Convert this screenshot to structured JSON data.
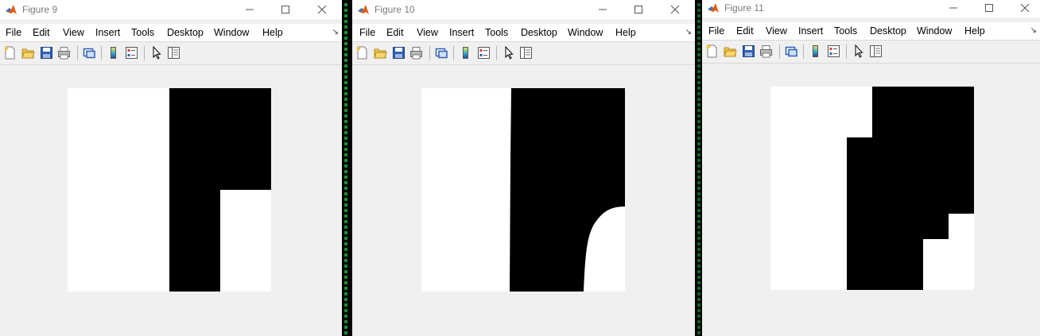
{
  "figures": [
    {
      "title": "Figure 9",
      "menu": [
        "File",
        "Edit",
        "View",
        "Insert",
        "Tools",
        "Desktop",
        "Window",
        "Help"
      ]
    },
    {
      "title": "Figure 10",
      "menu": [
        "File",
        "Edit",
        "View",
        "Insert",
        "Tools",
        "Desktop",
        "Window",
        "Help"
      ]
    },
    {
      "title": "Figure 11",
      "menu": [
        "File",
        "Edit",
        "View",
        "Insert",
        "Tools",
        "Desktop",
        "Window",
        "Help"
      ]
    }
  ],
  "menu_overflow_glyph": "↘",
  "toolbar_icons": [
    "new-figure-icon",
    "open-file-icon",
    "save-icon",
    "print-icon",
    "link-plot-icon",
    "colorbar-icon",
    "legend-icon",
    "edit-plot-arrow-icon",
    "property-inspector-icon"
  ],
  "window_controls": [
    "minimize-icon",
    "maximize-icon",
    "close-icon"
  ],
  "colors": {
    "matlab_logo": "#e35b13",
    "divider_text": "#1fa83a"
  }
}
